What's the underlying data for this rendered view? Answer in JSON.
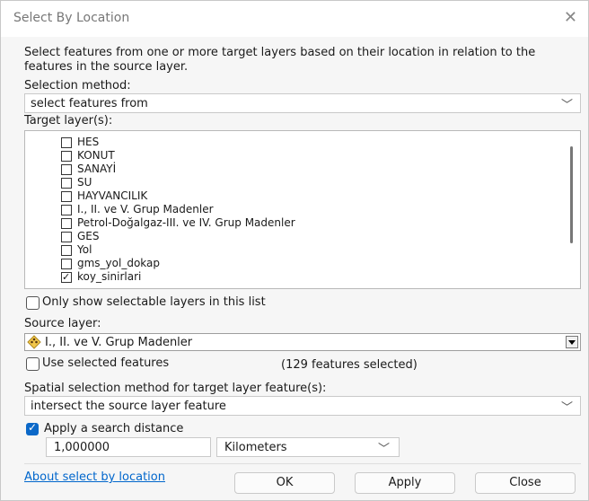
{
  "window": {
    "title": "Select By Location"
  },
  "description": "Select features from one or more target layers based on their location in relation to the features in the source layer.",
  "selection_method": {
    "label": "Selection method:",
    "value": "select features from"
  },
  "target_layers": {
    "label": "Target layer(s):",
    "items": [
      {
        "name": "HES",
        "checked": false
      },
      {
        "name": "KONUT",
        "checked": false
      },
      {
        "name": "SANAYİ",
        "checked": false
      },
      {
        "name": "SU",
        "checked": false
      },
      {
        "name": "HAYVANCILIK",
        "checked": false
      },
      {
        "name": "I., II. ve V. Grup Madenler",
        "checked": false
      },
      {
        "name": "Petrol-Doğalgaz-III. ve IV. Grup Madenler",
        "checked": false
      },
      {
        "name": "GES",
        "checked": false
      },
      {
        "name": "Yol",
        "checked": false
      },
      {
        "name": "gms_yol_dokap",
        "checked": false
      },
      {
        "name": "koy_sinirlari",
        "checked": true
      }
    ]
  },
  "only_selectable": {
    "label": "Only show selectable layers in this list",
    "checked": false
  },
  "source_layer": {
    "label": "Source layer:",
    "value": "I., II. ve V. Grup Madenler",
    "icon": "point-layer-icon"
  },
  "use_selected": {
    "label": "Use selected features",
    "checked": false,
    "count_text": "(129 features selected)"
  },
  "spatial_method": {
    "label": "Spatial selection method for target layer feature(s):",
    "value": "intersect the source layer feature"
  },
  "search_distance": {
    "label": "Apply a search distance",
    "checked": true,
    "value": "1,000000",
    "unit": "Kilometers"
  },
  "footer": {
    "link": "About select by location",
    "ok": "OK",
    "apply": "Apply",
    "close": "Close"
  },
  "colors": {
    "accent": "#0b68c8",
    "link": "#0066cc"
  }
}
